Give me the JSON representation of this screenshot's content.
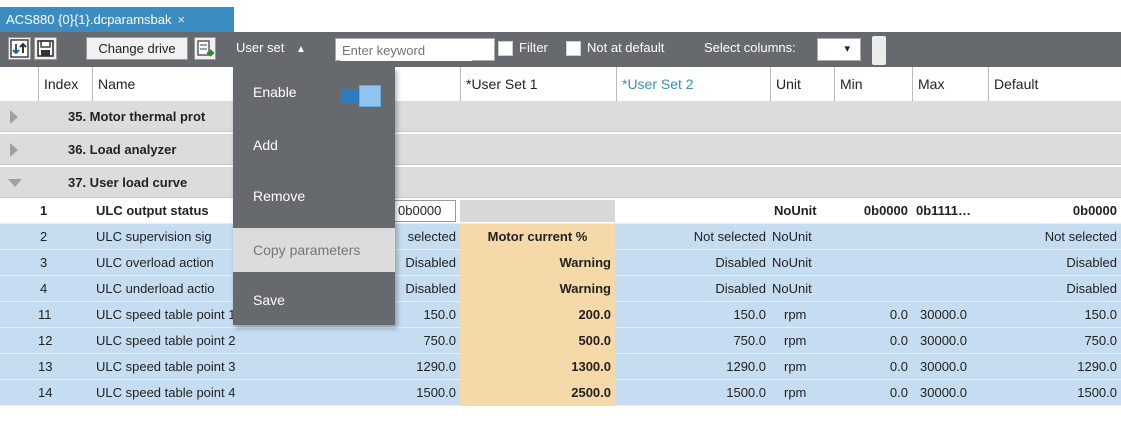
{
  "tab": {
    "title": "ACS880 {0}{1}.dcparamsbak",
    "close": "×"
  },
  "toolbar": {
    "change_drive": "Change drive",
    "user_set": "User set",
    "user_set_arrow": "▲",
    "keyword_placeholder": "Enter keyword",
    "filter": "Filter",
    "not_at_default": "Not at default",
    "select_columns": "Select columns:",
    "select_columns_arrow": "▾"
  },
  "columns": {
    "index": "Index",
    "name": "Name",
    "user_set_1": "*User Set 1",
    "user_set_2": "*User Set 2",
    "unit": "Unit",
    "min": "Min",
    "max": "Max",
    "default": "Default"
  },
  "groups": [
    {
      "label": "35. Motor thermal prot"
    },
    {
      "label": "36. Load analyzer"
    },
    {
      "label": "37. User load curve"
    }
  ],
  "rows": [
    {
      "index": "1",
      "name": "ULC output status",
      "value": "0b0000",
      "us1": "",
      "us2": "",
      "unit": "NoUnit",
      "min": "0b0000",
      "max": "0b1111…",
      "default": "0b0000"
    },
    {
      "index": "2",
      "name": "ULC supervision sig",
      "value": "selected",
      "us1": "Motor current %",
      "us2": "Not selected",
      "unit": "NoUnit",
      "min": "",
      "max": "",
      "default": "Not selected"
    },
    {
      "index": "3",
      "name": "ULC overload action",
      "value": "Disabled",
      "us1": "Warning",
      "us2": "Disabled",
      "unit": "NoUnit",
      "min": "",
      "max": "",
      "default": "Disabled"
    },
    {
      "index": "4",
      "name": "ULC underload actio",
      "value": "Disabled",
      "us1": "Warning",
      "us2": "Disabled",
      "unit": "NoUnit",
      "min": "",
      "max": "",
      "default": "Disabled"
    },
    {
      "index": "11",
      "name": "ULC speed table point 1",
      "value": "150.0",
      "us1": "200.0",
      "us2": "150.0",
      "unit": "rpm",
      "min": "0.0",
      "max": "30000.0",
      "default": "150.0"
    },
    {
      "index": "12",
      "name": "ULC speed table point 2",
      "value": "750.0",
      "us1": "500.0",
      "us2": "750.0",
      "unit": "rpm",
      "min": "0.0",
      "max": "30000.0",
      "default": "750.0"
    },
    {
      "index": "13",
      "name": "ULC speed table point 3",
      "value": "1290.0",
      "us1": "1300.0",
      "us2": "1290.0",
      "unit": "rpm",
      "min": "0.0",
      "max": "30000.0",
      "default": "1290.0"
    },
    {
      "index": "14",
      "name": "ULC speed table point 4",
      "value": "1500.0",
      "us1": "2500.0",
      "us2": "1500.0",
      "unit": "rpm",
      "min": "0.0",
      "max": "30000.0",
      "default": "1500.0"
    }
  ],
  "menu": {
    "enable": "Enable",
    "enable_on": true,
    "add": "Add",
    "remove": "Remove",
    "copy_parameters": "Copy parameters",
    "save": "Save"
  },
  "colors": {
    "tab": "#3c8cc4",
    "toolbar": "#666a6e",
    "row_blue": "#c6dcf0",
    "user_set_1": "#f6d9a8",
    "accent_blue": "#3c8cc4"
  },
  "icons": [
    "import-icon",
    "save-icon",
    "export-icon"
  ]
}
